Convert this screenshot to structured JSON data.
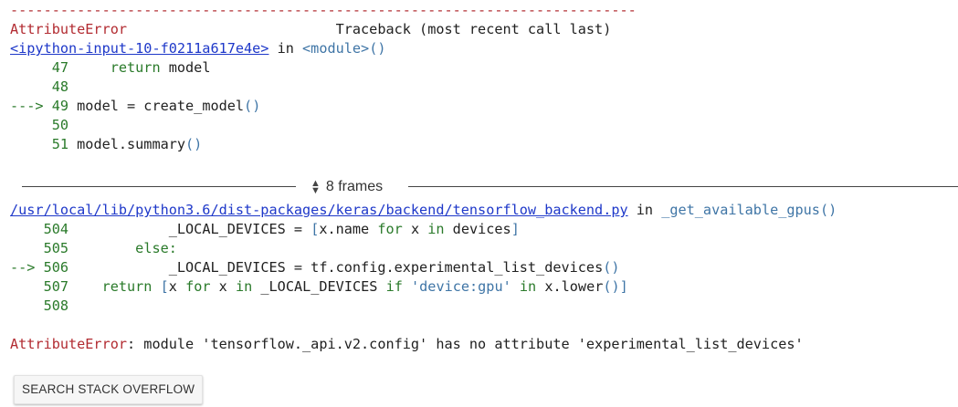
{
  "traceback": {
    "dashes": "---------------------------------------------------------------------------",
    "error_name": "AttributeError",
    "header_right": "Traceback (most recent call last)",
    "frame1": {
      "file_link": "<ipython-input-10-f0211a617e4e>",
      "in_text": " in ",
      "func": "<module>",
      "parens": "()",
      "lines": [
        {
          "prefix": "     ",
          "num": "47",
          "code": "     return model"
        },
        {
          "prefix": "     ",
          "num": "48",
          "code": ""
        },
        {
          "prefix": "---> ",
          "num": "49",
          "code": " model = create_model",
          "tail": "()"
        },
        {
          "prefix": "     ",
          "num": "50",
          "code": ""
        },
        {
          "prefix": "     ",
          "num": "51",
          "code": " model.summary",
          "tail": "()"
        }
      ]
    },
    "frames_toggle": {
      "icon": "expand-collapse-chevron-icon",
      "label": "8 frames"
    },
    "frame2": {
      "file_link": "/usr/local/lib/python3.6/dist-packages/keras/backend/tensorflow_backend.py",
      "in_text": " in ",
      "func": "_get_available_gpus",
      "parens": "()",
      "lines": [
        {
          "prefix": "    ",
          "num": "504",
          "parts": [
            {
              "t": "            _LOCAL_DEVICES = ",
              "c": ""
            },
            {
              "t": "[",
              "c": "blue"
            },
            {
              "t": "x.name ",
              "c": ""
            },
            {
              "t": "for",
              "c": "green"
            },
            {
              "t": " x ",
              "c": ""
            },
            {
              "t": "in",
              "c": "green"
            },
            {
              "t": " devices",
              "c": ""
            },
            {
              "t": "]",
              "c": "blue"
            }
          ]
        },
        {
          "prefix": "    ",
          "num": "505",
          "parts": [
            {
              "t": "        ",
              "c": ""
            },
            {
              "t": "else:",
              "c": "green"
            }
          ]
        },
        {
          "prefix": "--> ",
          "num": "506",
          "parts": [
            {
              "t": "            _LOCAL_DEVICES = tf.config.experimental_list_devices",
              "c": ""
            },
            {
              "t": "()",
              "c": "blue"
            }
          ]
        },
        {
          "prefix": "    ",
          "num": "507",
          "parts": [
            {
              "t": "    ",
              "c": ""
            },
            {
              "t": "return",
              "c": "green"
            },
            {
              "t": " ",
              "c": ""
            },
            {
              "t": "[",
              "c": "blue"
            },
            {
              "t": "x ",
              "c": ""
            },
            {
              "t": "for",
              "c": "green"
            },
            {
              "t": " x ",
              "c": ""
            },
            {
              "t": "in",
              "c": "green"
            },
            {
              "t": " _LOCAL_DEVICES ",
              "c": ""
            },
            {
              "t": "if",
              "c": "green"
            },
            {
              "t": " ",
              "c": ""
            },
            {
              "t": "'device:gpu'",
              "c": "blue"
            },
            {
              "t": " ",
              "c": ""
            },
            {
              "t": "in",
              "c": "green"
            },
            {
              "t": " x.lower",
              "c": ""
            },
            {
              "t": "()]",
              "c": "blue"
            }
          ]
        },
        {
          "prefix": "    ",
          "num": "508",
          "parts": []
        }
      ]
    },
    "final_error": {
      "name": "AttributeError",
      "message": ": module 'tensorflow._api.v2.config' has no attribute 'experimental_list_devices'"
    }
  },
  "button": {
    "label": "SEARCH STACK OVERFLOW"
  },
  "colors": {
    "error_red": "#b22b31",
    "keyword_green": "#2a7a2a",
    "builtin_blue": "#3f75a6",
    "link_blue": "#1e38c9"
  }
}
